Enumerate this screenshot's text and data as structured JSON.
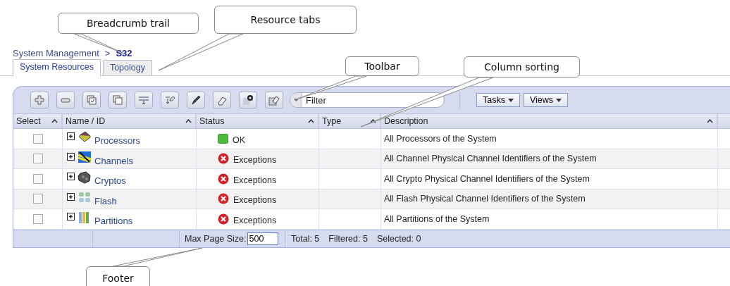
{
  "callouts": [
    {
      "label": "Breadcrumb trail"
    },
    {
      "label": "Resource tabs"
    },
    {
      "label": "Toolbar"
    },
    {
      "label": "Column sorting"
    },
    {
      "label": "Footer"
    }
  ],
  "breadcrumb": {
    "items": [
      "System Management",
      "S32"
    ],
    "separator": ">"
  },
  "tabs": [
    {
      "label": "System Resources",
      "selected": true
    },
    {
      "label": "Topology",
      "selected": false
    }
  ],
  "filter": {
    "placeholder": "Filter"
  },
  "menus": [
    {
      "label": "Tasks"
    },
    {
      "label": "Views"
    }
  ],
  "table": {
    "columns": [
      {
        "label": "Select",
        "sortable": true
      },
      {
        "label": "Name / ID",
        "sortable": true
      },
      {
        "label": "Status",
        "sortable": true
      },
      {
        "label": "Type",
        "sortable": true
      },
      {
        "label": "Description",
        "sortable": true
      }
    ],
    "rows": [
      {
        "checked": false,
        "kind": "processor",
        "name": "Processors",
        "status": {
          "kind": "ok",
          "text": "OK"
        },
        "description": "All Processors of the System"
      },
      {
        "checked": false,
        "kind": "channel",
        "name": "Channels",
        "status": {
          "kind": "exception",
          "text": "Exceptions"
        },
        "description": "All Channel Physical Channel Identifiers of the System"
      },
      {
        "checked": false,
        "kind": "crypto",
        "name": "Cryptos",
        "status": {
          "kind": "exception",
          "text": "Exceptions"
        },
        "description": "All Crypto Physical Channel Identifiers of the System"
      },
      {
        "checked": false,
        "kind": "flash",
        "name": "Flash",
        "status": {
          "kind": "exception",
          "text": "Exceptions"
        },
        "description": "All Flash Physical Channel Identifiers of the System"
      },
      {
        "checked": false,
        "kind": "partition",
        "name": "Partitions",
        "status": {
          "kind": "exception",
          "text": "Exceptions"
        },
        "description": "All Partitions of the System"
      }
    ]
  },
  "footer": {
    "page_size_label": "Max Page Size:",
    "page_size": "500",
    "total": "Total: 5",
    "filtered": "Filtered: 5",
    "selected": "Selected: 0"
  }
}
